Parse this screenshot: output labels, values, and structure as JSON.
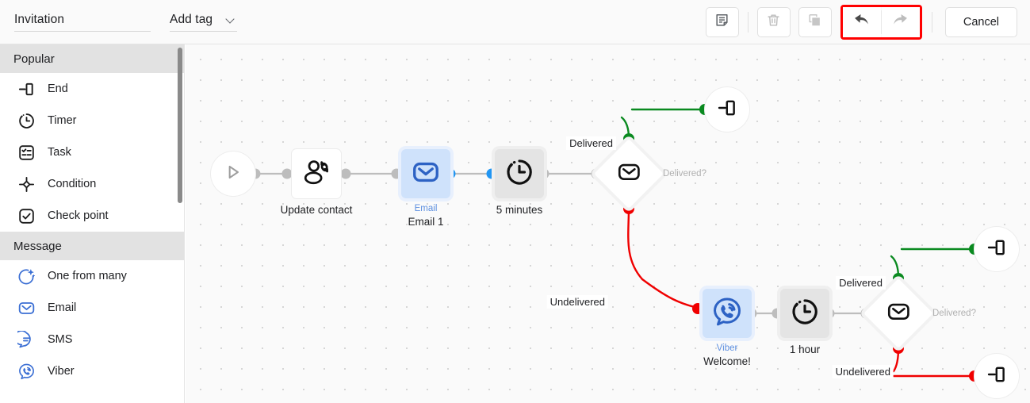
{
  "header": {
    "title_value": "Invitation",
    "title_placeholder": "Name",
    "tag_label": "Add tag",
    "chevron_icon": "chevron-down-icon",
    "cancel_label": "Cancel"
  },
  "toolbar": {
    "buttons": [
      {
        "name": "note-button",
        "icon": "note-icon",
        "enabled": true
      },
      {
        "name": "delete-button",
        "icon": "trash-icon",
        "enabled": false
      },
      {
        "name": "copy-button",
        "icon": "copy-icon",
        "enabled": false
      },
      {
        "name": "undo-button",
        "icon": "undo-arrow-icon",
        "enabled": true
      },
      {
        "name": "redo-button",
        "icon": "redo-arrow-icon",
        "enabled": false
      }
    ],
    "highlight_color": "#ff0000"
  },
  "sidebar": {
    "sections": [
      {
        "heading": "Popular",
        "items": [
          {
            "label": "End",
            "icon": "end-icon",
            "color": "#1a1a1a"
          },
          {
            "label": "Timer",
            "icon": "timer-icon",
            "color": "#1a1a1a"
          },
          {
            "label": "Task",
            "icon": "task-icon",
            "color": "#1a1a1a"
          },
          {
            "label": "Condition",
            "icon": "condition-icon",
            "color": "#1a1a1a"
          },
          {
            "label": "Check point",
            "icon": "check-point-icon",
            "color": "#1a1a1a"
          }
        ]
      },
      {
        "heading": "Message",
        "items": [
          {
            "label": "One from many",
            "icon": "one-from-many-icon",
            "color": "#3b6fd4"
          },
          {
            "label": "Email",
            "icon": "email-icon",
            "color": "#3b6fd4"
          },
          {
            "label": "SMS",
            "icon": "sms-icon",
            "color": "#3b6fd4"
          },
          {
            "label": "Viber",
            "icon": "viber-icon",
            "color": "#3b6fd4"
          }
        ]
      }
    ]
  },
  "canvas": {
    "nodes": [
      {
        "id": "start",
        "name": "start-node",
        "type": "start",
        "icon": "play-icon",
        "label": "",
        "sublabel": ""
      },
      {
        "id": "update",
        "name": "update-contact-node",
        "type": "action",
        "icon": "update-contact-icon",
        "label": "Update contact",
        "sublabel": ""
      },
      {
        "id": "email1",
        "name": "email-node",
        "type": "message",
        "icon": "email-icon",
        "label": "Email 1",
        "sublabel": "Email",
        "selected": true
      },
      {
        "id": "timer5",
        "name": "timer-node-5min",
        "type": "timer",
        "icon": "timer-icon",
        "label": "5 minutes",
        "sublabel": ""
      },
      {
        "id": "cond1",
        "name": "condition-node-email",
        "type": "condition",
        "icon": "email-icon",
        "label": "",
        "sublabel": "",
        "question": "Delivered?"
      },
      {
        "id": "end1",
        "name": "end-node-delivered-1",
        "type": "end",
        "icon": "end-icon",
        "label": "",
        "sublabel": ""
      },
      {
        "id": "viber",
        "name": "viber-node",
        "type": "message",
        "icon": "viber-icon",
        "label": "Welcome!",
        "sublabel": "Viber",
        "selected": true
      },
      {
        "id": "timer1h",
        "name": "timer-node-1hour",
        "type": "timer",
        "icon": "timer-icon",
        "label": "1 hour",
        "sublabel": ""
      },
      {
        "id": "cond2",
        "name": "condition-node-viber",
        "type": "condition",
        "icon": "email-icon",
        "label": "",
        "sublabel": "",
        "question": "Delivered?"
      },
      {
        "id": "end2",
        "name": "end-node-delivered-2",
        "type": "end",
        "icon": "end-icon",
        "label": "",
        "sublabel": ""
      },
      {
        "id": "end3",
        "name": "end-node-undelivered",
        "type": "end",
        "icon": "end-icon",
        "label": "",
        "sublabel": ""
      }
    ],
    "edge_labels": {
      "delivered_1": "Delivered",
      "undelivered_1": "Undelivered",
      "delivered_2": "Delivered",
      "undelivered_2": "Undelivered"
    },
    "condition_labels": {
      "cond1": "Delivered?",
      "cond2": "Delivered?"
    },
    "colors": {
      "delivered": "#0a8a20",
      "undelivered": "#f00000",
      "default_edge": "#bdbdbd",
      "selected_port": "#2196f3",
      "accent_blue": "#3b6fd4"
    }
  }
}
